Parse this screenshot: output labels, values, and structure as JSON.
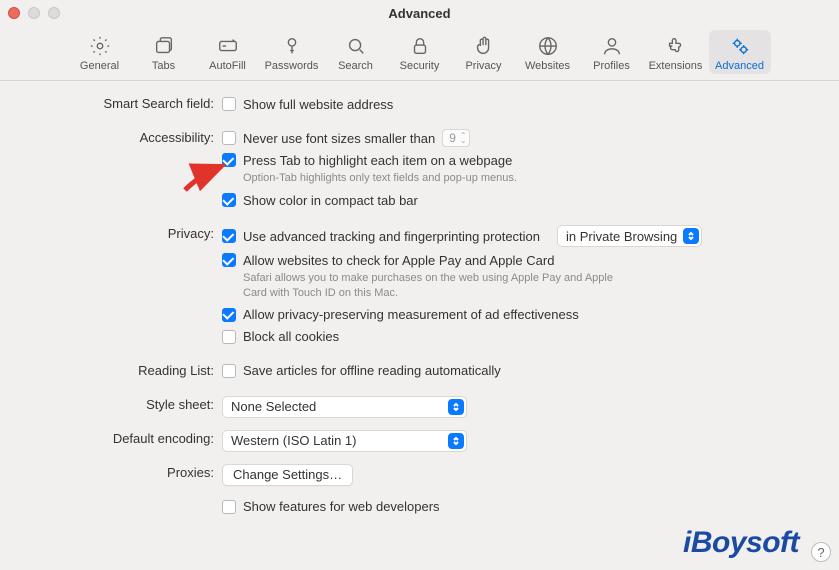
{
  "window": {
    "title": "Advanced"
  },
  "toolbar": {
    "items": [
      {
        "label": "General"
      },
      {
        "label": "Tabs"
      },
      {
        "label": "AutoFill"
      },
      {
        "label": "Passwords"
      },
      {
        "label": "Search"
      },
      {
        "label": "Security"
      },
      {
        "label": "Privacy"
      },
      {
        "label": "Websites"
      },
      {
        "label": "Profiles"
      },
      {
        "label": "Extensions"
      },
      {
        "label": "Advanced"
      }
    ],
    "active_index": 10
  },
  "sections": {
    "smart_search": {
      "label": "Smart Search field:",
      "show_full_url": {
        "text": "Show full website address",
        "checked": false
      }
    },
    "accessibility": {
      "label": "Accessibility:",
      "never_smaller": {
        "text": "Never use font sizes smaller than",
        "checked": false,
        "value": "9"
      },
      "press_tab": {
        "text": "Press Tab to highlight each item on a webpage",
        "checked": true
      },
      "press_tab_hint": "Option-Tab highlights only text fields and pop-up menus.",
      "show_color": {
        "text": "Show color in compact tab bar",
        "checked": true
      }
    },
    "privacy": {
      "label": "Privacy:",
      "advanced_tracking": {
        "text": "Use advanced tracking and fingerprinting protection",
        "checked": true,
        "mode": "in Private Browsing"
      },
      "apple_pay": {
        "text": "Allow websites to check for Apple Pay and Apple Card",
        "checked": true
      },
      "apple_pay_hint": "Safari allows you to make purchases on the web using Apple Pay and Apple Card with Touch ID on this Mac.",
      "ad_measure": {
        "text": "Allow privacy-preserving measurement of ad effectiveness",
        "checked": true
      },
      "block_cookies": {
        "text": "Block all cookies",
        "checked": false
      }
    },
    "reading_list": {
      "label": "Reading List:",
      "save_offline": {
        "text": "Save articles for offline reading automatically",
        "checked": false
      }
    },
    "style_sheet": {
      "label": "Style sheet:",
      "value": "None Selected"
    },
    "default_encoding": {
      "label": "Default encoding:",
      "value": "Western (ISO Latin 1)"
    },
    "proxies": {
      "label": "Proxies:",
      "button": "Change Settings…"
    },
    "developer": {
      "show_dev": {
        "text": "Show features for web developers",
        "checked": false
      }
    }
  },
  "watermark": "iBoysoft",
  "help": "?"
}
